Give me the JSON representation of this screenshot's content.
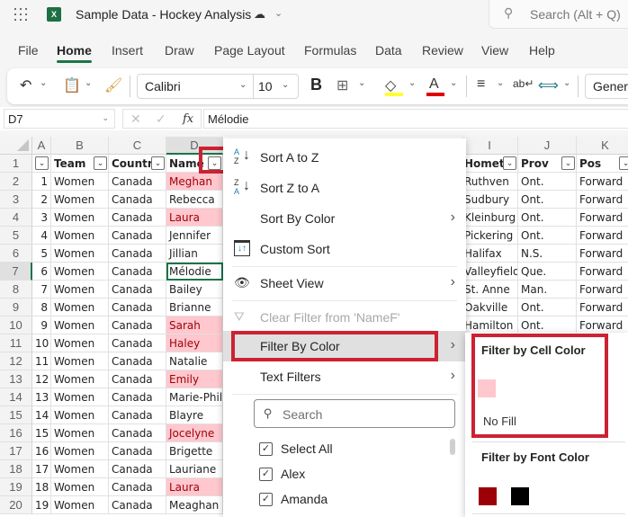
{
  "app": {
    "title": "Sample Data - Hockey Analysis",
    "search_placeholder": "Search (Alt + Q)"
  },
  "ribbon": {
    "tabs": [
      {
        "label": "File"
      },
      {
        "label": "Home",
        "active": true
      },
      {
        "label": "Insert"
      },
      {
        "label": "Draw"
      },
      {
        "label": "Page Layout"
      },
      {
        "label": "Formulas"
      },
      {
        "label": "Data"
      },
      {
        "label": "Review"
      },
      {
        "label": "View"
      },
      {
        "label": "Help"
      }
    ],
    "font_name": "Calibri",
    "font_size": "10",
    "bold_label": "B",
    "number_format": "General",
    "fill_color": "#ffff33",
    "font_color": "#e00000"
  },
  "formula_bar": {
    "name_box": "D7",
    "fx_label": "fx",
    "value": "Mélodie"
  },
  "sheet": {
    "columns": [
      "A",
      "B",
      "C",
      "D",
      "I",
      "J",
      "K"
    ],
    "headers": {
      "A": "",
      "B": "Team",
      "C": "Country",
      "D": "Name",
      "I": "Hometo",
      "J": "Prov",
      "K": "Pos"
    },
    "rows": [
      {
        "r": "2",
        "a": "1",
        "b": "Women",
        "c": "Canada",
        "d": "Meghan",
        "pink": true,
        "i": "Ruthven",
        "j": "Ont.",
        "k": "Forward"
      },
      {
        "r": "3",
        "a": "2",
        "b": "Women",
        "c": "Canada",
        "d": "Rebecca",
        "pink": false,
        "i": "Sudbury",
        "j": "Ont.",
        "k": "Forward"
      },
      {
        "r": "4",
        "a": "3",
        "b": "Women",
        "c": "Canada",
        "d": "Laura",
        "pink": true,
        "i": "Kleinburg",
        "j": "Ont.",
        "k": "Forward"
      },
      {
        "r": "5",
        "a": "4",
        "b": "Women",
        "c": "Canada",
        "d": "Jennifer",
        "pink": false,
        "i": "Pickering",
        "j": "Ont.",
        "k": "Forward"
      },
      {
        "r": "6",
        "a": "5",
        "b": "Women",
        "c": "Canada",
        "d": "Jillian",
        "pink": false,
        "i": "Halifax",
        "j": "N.S.",
        "k": "Forward"
      },
      {
        "r": "7",
        "a": "6",
        "b": "Women",
        "c": "Canada",
        "d": "Mélodie",
        "pink": false,
        "active": true,
        "i": "Valleyfield",
        "j": "Que.",
        "k": "Forward"
      },
      {
        "r": "8",
        "a": "7",
        "b": "Women",
        "c": "Canada",
        "d": "Bailey",
        "pink": false,
        "i": "St. Anne",
        "j": "Man.",
        "k": "Forward"
      },
      {
        "r": "9",
        "a": "8",
        "b": "Women",
        "c": "Canada",
        "d": "Brianne",
        "pink": false,
        "i": "Oakville",
        "j": "Ont.",
        "k": "Forward"
      },
      {
        "r": "10",
        "a": "9",
        "b": "Women",
        "c": "Canada",
        "d": "Sarah",
        "pink": true,
        "i": "Hamilton",
        "j": "Ont.",
        "k": "Forward"
      },
      {
        "r": "11",
        "a": "10",
        "b": "Women",
        "c": "Canada",
        "d": "Haley",
        "pink": true
      },
      {
        "r": "12",
        "a": "11",
        "b": "Women",
        "c": "Canada",
        "d": "Natalie",
        "pink": false
      },
      {
        "r": "13",
        "a": "12",
        "b": "Women",
        "c": "Canada",
        "d": "Emily",
        "pink": true
      },
      {
        "r": "14",
        "a": "13",
        "b": "Women",
        "c": "Canada",
        "d": "Marie-Phili",
        "pink": false
      },
      {
        "r": "15",
        "a": "14",
        "b": "Women",
        "c": "Canada",
        "d": "Blayre",
        "pink": false
      },
      {
        "r": "16",
        "a": "15",
        "b": "Women",
        "c": "Canada",
        "d": "Jocelyne",
        "pink": true
      },
      {
        "r": "17",
        "a": "16",
        "b": "Women",
        "c": "Canada",
        "d": "Brigette",
        "pink": false
      },
      {
        "r": "18",
        "a": "17",
        "b": "Women",
        "c": "Canada",
        "d": "Lauriane",
        "pink": false
      },
      {
        "r": "19",
        "a": "18",
        "b": "Women",
        "c": "Canada",
        "d": "Laura",
        "pink": true
      },
      {
        "r": "20",
        "a": "19",
        "b": "Women",
        "c": "Canada",
        "d": "Meaghan",
        "pink": false
      }
    ]
  },
  "filter_menu": {
    "sort_az": "Sort A to Z",
    "sort_za": "Sort Z to A",
    "sort_by_color": "Sort By Color",
    "custom_sort": "Custom Sort",
    "sheet_view": "Sheet View",
    "clear_filter": "Clear Filter from 'NameF'",
    "filter_by_color": "Filter By Color",
    "text_filters": "Text Filters",
    "search_placeholder": "Search",
    "items": [
      {
        "label": "Select All",
        "checked": true
      },
      {
        "label": "Alex",
        "checked": true
      },
      {
        "label": "Amanda",
        "checked": true
      }
    ]
  },
  "color_submenu": {
    "cell_color_title": "Filter by Cell Color",
    "cell_colors": [
      "#ffc7ce"
    ],
    "no_fill": "No Fill",
    "font_color_title": "Filter by Font Color",
    "font_colors": [
      "#9c0006",
      "#000000"
    ]
  },
  "colors": {
    "accent": "#1a7548",
    "highlight_outline": "#cc2233",
    "pink_fill": "#ffc7ce",
    "pink_text": "#9c0006"
  }
}
